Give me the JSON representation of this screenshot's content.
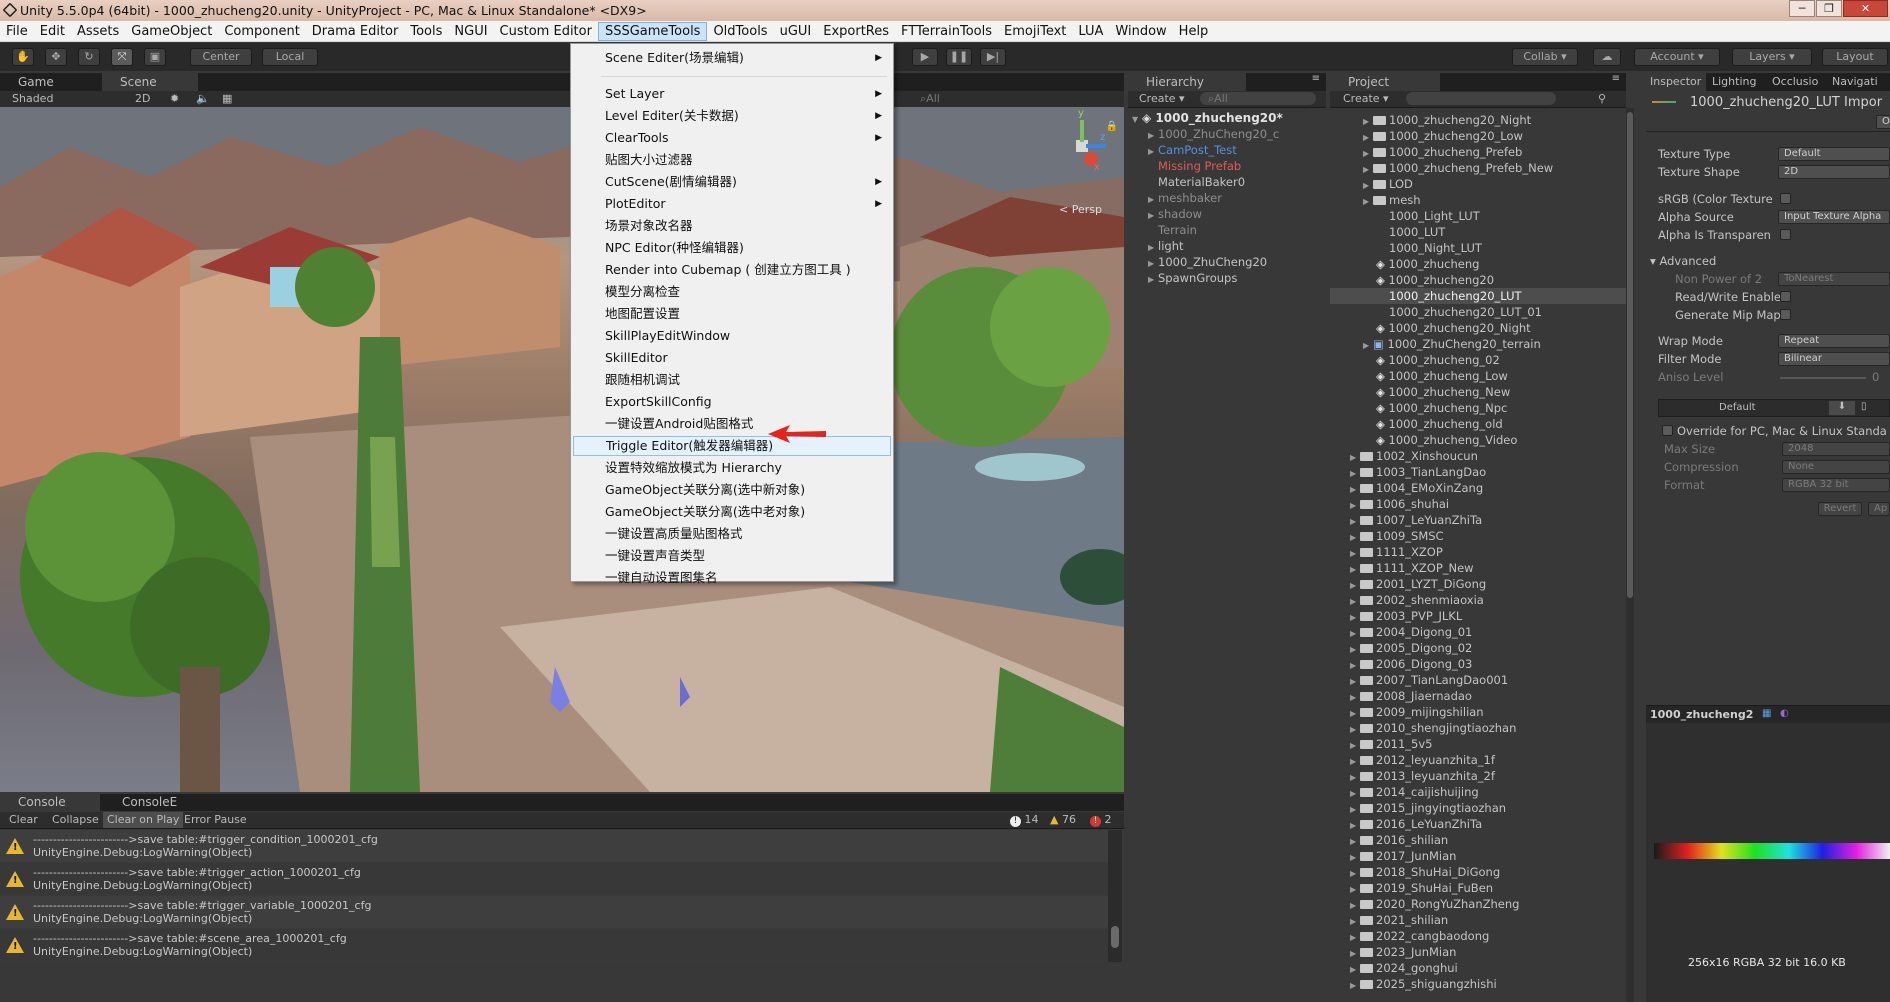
{
  "window": {
    "title": "Unity 5.5.0p4 (64bit) - 1000_zhucheng20.unity - UnityProject - PC, Mac & Linux Standalone* <DX9>"
  },
  "menubar": [
    "File",
    "Edit",
    "Assets",
    "GameObject",
    "Component",
    "Drama Editor",
    "Tools",
    "NGUI",
    "Custom Editor",
    "SSSGameTools",
    "OldTools",
    "uGUI",
    "ExportRes",
    "FTTerrainTools",
    "EmojiText",
    "LUA",
    "Window",
    "Help"
  ],
  "menu_active": "SSSGameTools",
  "toolbar": {
    "center": "Center",
    "local": "Local",
    "collab": "Collab ▾",
    "account": "Account",
    "layers": "Layers",
    "layout": "Layout"
  },
  "scene_view": {
    "tabs": [
      "Game",
      "Scene"
    ],
    "shading": "Shaded",
    "mode_2d": "2D",
    "search": "All",
    "gizmo": {
      "y": "y",
      "x": "x",
      "z": "z",
      "persp": "Persp"
    }
  },
  "dropdown": {
    "items": [
      {
        "label": "Scene Editer(场景编辑)",
        "sub": true
      },
      {
        "sep": true
      },
      {
        "label": "Set Layer",
        "sub": true
      },
      {
        "label": "Level Editer(关卡数据)",
        "sub": true
      },
      {
        "label": "ClearTools",
        "sub": true
      },
      {
        "label": "贴图大小过滤器"
      },
      {
        "label": "CutScene(剧情编辑器)",
        "sub": true
      },
      {
        "label": "PlotEditor",
        "sub": true
      },
      {
        "label": "场景对象改名器"
      },
      {
        "label": "NPC Editor(种怪编辑器)"
      },
      {
        "label": "Render into Cubemap ( 创建立方图工具 )"
      },
      {
        "label": "模型分离检查"
      },
      {
        "label": "地图配置设置"
      },
      {
        "label": "SkillPlayEditWindow"
      },
      {
        "label": "SkillEditor"
      },
      {
        "label": "跟随相机调试"
      },
      {
        "label": "ExportSkillConfig"
      },
      {
        "label": "一键设置Android贴图格式"
      },
      {
        "label": "Triggle Editor(触发器编辑器)",
        "hl": true
      },
      {
        "label": "设置特效缩放模式为 Hierarchy"
      },
      {
        "label": "GameObject关联分离(选中新对象)"
      },
      {
        "label": "GameObject关联分离(选中老对象)"
      },
      {
        "label": "一键设置高质量贴图格式"
      },
      {
        "label": "一键设置声音类型"
      },
      {
        "label": "一键自动设置图集名"
      }
    ]
  },
  "hierarchy": {
    "tab": "Hierarchy",
    "create": "Create ▾",
    "search": "All",
    "scene_name": "1000_zhucheng20*",
    "items": [
      {
        "label": "1000_ZhuCheng20_c",
        "tri": true,
        "style": "dim"
      },
      {
        "label": "CamPost_Test",
        "tri": true,
        "style": "blue"
      },
      {
        "label": "Missing Prefab",
        "tri": false,
        "style": "red"
      },
      {
        "label": "MaterialBaker0",
        "tri": false,
        "style": "norm"
      },
      {
        "label": "meshbaker",
        "tri": true,
        "style": "dim"
      },
      {
        "label": "shadow",
        "tri": true,
        "style": "dim"
      },
      {
        "label": "Terrain",
        "tri": false,
        "style": "dim"
      },
      {
        "label": "light",
        "tri": true,
        "style": "norm"
      },
      {
        "label": "1000_ZhuCheng20",
        "tri": true,
        "style": "norm"
      },
      {
        "label": "SpawnGroups",
        "tri": true,
        "style": "norm"
      }
    ]
  },
  "project": {
    "tab": "Project",
    "create": "Create ▾",
    "items": [
      {
        "label": "1000_zhucheng20_Night",
        "indent": 3,
        "kind": "folder"
      },
      {
        "label": "1000_zhucheng20_Low",
        "indent": 3,
        "kind": "folder"
      },
      {
        "label": "1000_zhucheng_Prefeb",
        "indent": 3,
        "kind": "folder"
      },
      {
        "label": "1000_zhucheng_Prefeb_New",
        "indent": 3,
        "kind": "folder"
      },
      {
        "label": "LOD",
        "indent": 3,
        "kind": "folder"
      },
      {
        "label": "mesh",
        "indent": 3,
        "kind": "folder"
      },
      {
        "label": "1000_Light_LUT",
        "indent": 4,
        "kind": "file"
      },
      {
        "label": "1000_LUT",
        "indent": 4,
        "kind": "file"
      },
      {
        "label": "1000_Night_LUT",
        "indent": 4,
        "kind": "file"
      },
      {
        "label": "1000_zhucheng",
        "indent": 4,
        "kind": "unity"
      },
      {
        "label": "1000_zhucheng20",
        "indent": 4,
        "kind": "unity"
      },
      {
        "label": "1000_zhucheng20_LUT",
        "indent": 4,
        "kind": "file",
        "sel": true
      },
      {
        "label": "1000_zhucheng20_LUT_01",
        "indent": 4,
        "kind": "file"
      },
      {
        "label": "1000_zhucheng20_Night",
        "indent": 4,
        "kind": "unity"
      },
      {
        "label": "1000_ZhuCheng20_terrain",
        "indent": 3,
        "kind": "prefab"
      },
      {
        "label": "1000_zhucheng_02",
        "indent": 4,
        "kind": "unity"
      },
      {
        "label": "1000_zhucheng_Low",
        "indent": 4,
        "kind": "unity"
      },
      {
        "label": "1000_zhucheng_New",
        "indent": 4,
        "kind": "unity"
      },
      {
        "label": "1000_zhucheng_Npc",
        "indent": 4,
        "kind": "unity"
      },
      {
        "label": "1000_zhucheng_old",
        "indent": 4,
        "kind": "unity"
      },
      {
        "label": "1000_zhucheng_Video",
        "indent": 4,
        "kind": "unity"
      },
      {
        "label": "1002_Xinshoucun",
        "indent": 2,
        "kind": "folder"
      },
      {
        "label": "1003_TianLangDao",
        "indent": 2,
        "kind": "folder"
      },
      {
        "label": "1004_EMoXinZang",
        "indent": 2,
        "kind": "folder"
      },
      {
        "label": "1006_shuhai",
        "indent": 2,
        "kind": "folder"
      },
      {
        "label": "1007_LeYuanZhiTa",
        "indent": 2,
        "kind": "folder"
      },
      {
        "label": "1009_SMSC",
        "indent": 2,
        "kind": "folder"
      },
      {
        "label": "1111_XZOP",
        "indent": 2,
        "kind": "folder"
      },
      {
        "label": "1111_XZOP_New",
        "indent": 2,
        "kind": "folder"
      },
      {
        "label": "2001_LYZT_DiGong",
        "indent": 2,
        "kind": "folder"
      },
      {
        "label": "2002_shenmiaoxia",
        "indent": 2,
        "kind": "folder"
      },
      {
        "label": "2003_PVP_JLKL",
        "indent": 2,
        "kind": "folder"
      },
      {
        "label": "2004_Digong_01",
        "indent": 2,
        "kind": "folder"
      },
      {
        "label": "2005_Digong_02",
        "indent": 2,
        "kind": "folder"
      },
      {
        "label": "2006_Digong_03",
        "indent": 2,
        "kind": "folder"
      },
      {
        "label": "2007_TianLangDao001",
        "indent": 2,
        "kind": "folder"
      },
      {
        "label": "2008_Jiaernadao",
        "indent": 2,
        "kind": "folder"
      },
      {
        "label": "2009_mijingshilian",
        "indent": 2,
        "kind": "folder"
      },
      {
        "label": "2010_shengjingtiaozhan",
        "indent": 2,
        "kind": "folder"
      },
      {
        "label": "2011_5v5",
        "indent": 2,
        "kind": "folder"
      },
      {
        "label": "2012_leyuanzhita_1f",
        "indent": 2,
        "kind": "folder"
      },
      {
        "label": "2013_leyuanzhita_2f",
        "indent": 2,
        "kind": "folder"
      },
      {
        "label": "2014_caijishuijing",
        "indent": 2,
        "kind": "folder"
      },
      {
        "label": "2015_jingyingtiaozhan",
        "indent": 2,
        "kind": "folder"
      },
      {
        "label": "2016_LeYuanZhiTa",
        "indent": 2,
        "kind": "folder"
      },
      {
        "label": "2016_shilian",
        "indent": 2,
        "kind": "folder"
      },
      {
        "label": "2017_JunMian",
        "indent": 2,
        "kind": "folder"
      },
      {
        "label": "2018_ShuHai_DiGong",
        "indent": 2,
        "kind": "folder"
      },
      {
        "label": "2019_ShuHai_FuBen",
        "indent": 2,
        "kind": "folder"
      },
      {
        "label": "2020_RongYuZhanZheng",
        "indent": 2,
        "kind": "folder"
      },
      {
        "label": "2021_shilian",
        "indent": 2,
        "kind": "folder"
      },
      {
        "label": "2022_cangbaodong",
        "indent": 2,
        "kind": "folder"
      },
      {
        "label": "2023_JunMian",
        "indent": 2,
        "kind": "folder"
      },
      {
        "label": "2024_gonghui",
        "indent": 2,
        "kind": "folder"
      },
      {
        "label": "2025_shiguangzhishi",
        "indent": 2,
        "kind": "folder"
      }
    ]
  },
  "inspector": {
    "tabs": [
      "Inspector",
      "Lighting",
      "Occlusio",
      "Navigati"
    ],
    "asset_title": "1000_zhucheng20_LUT Impor",
    "open": "O",
    "fields": [
      {
        "label": "Texture Type",
        "value": "Default"
      },
      {
        "label": "Texture Shape",
        "value": "2D"
      }
    ],
    "srgb": "sRGB (Color Texture",
    "alpha_source": {
      "label": "Alpha Source",
      "value": "Input Texture Alpha"
    },
    "alpha_transparent": "Alpha Is Transparen",
    "advanced": "Advanced",
    "npot": {
      "label": "Non Power of 2",
      "value": "ToNearest"
    },
    "readwrite": "Read/Write Enable",
    "mipmap": "Generate Mip Map",
    "wrap": {
      "label": "Wrap Mode",
      "value": "Repeat"
    },
    "filter": {
      "label": "Filter Mode",
      "value": "Bilinear"
    },
    "aniso": {
      "label": "Aniso Level",
      "value": "0"
    },
    "platform_default": "Default",
    "override": "Override for PC, Mac & Linux Standa",
    "maxsize": {
      "label": "Max Size",
      "value": "2048"
    },
    "compression": {
      "label": "Compression",
      "value": "None"
    },
    "format": {
      "label": "Format",
      "value": "RGBA 32 bit"
    },
    "revert": "Revert",
    "apply": "Ap",
    "preview_title": "1000_zhucheng2",
    "preview_info": "256x16  RGBA 32 bit   16.0 KB"
  },
  "console": {
    "tabs": [
      "Console",
      "ConsoleE"
    ],
    "buttons": [
      "Clear",
      "Collapse",
      "Clear on Play",
      "Error Pause"
    ],
    "counts": {
      "info": "14",
      "warn": "76",
      "error": "2"
    },
    "rows": [
      {
        "line1": "------------------------>save table:#trigger_condition_1000201_cfg",
        "line2": "UnityEngine.Debug:LogWarning(Object)"
      },
      {
        "line1": "------------------------>save table:#trigger_action_1000201_cfg",
        "line2": "UnityEngine.Debug:LogWarning(Object)"
      },
      {
        "line1": "------------------------>save table:#trigger_variable_1000201_cfg",
        "line2": "UnityEngine.Debug:LogWarning(Object)"
      },
      {
        "line1": "------------------------>save table:#scene_area_1000201_cfg",
        "line2": "UnityEngine.Debug:LogWarning(Object)"
      }
    ]
  }
}
